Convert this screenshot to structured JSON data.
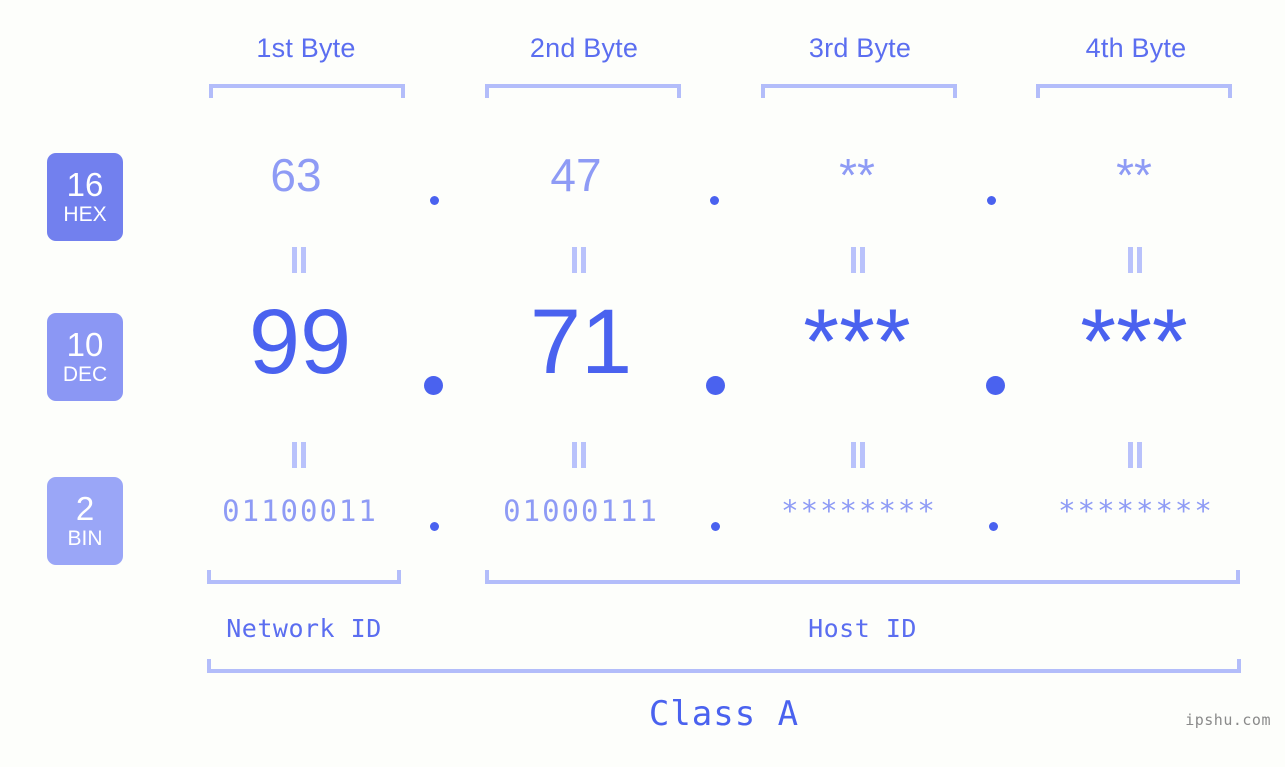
{
  "page": {
    "background": "#fdfefb",
    "watermark": "ipshu.com"
  },
  "colors": {
    "accent_strong": "#4a62ef",
    "accent_medium": "#5b6ef0",
    "accent_light": "#8e9bf5",
    "bracket": "#b3bdfa",
    "connector": "#b9c2fb",
    "badge_hex": "#7280ee",
    "badge_dec": "#8b97f4",
    "badge_bin": "#9aa6f7",
    "watermark": "#8a8a8a"
  },
  "header": {
    "bytes": [
      {
        "label": "1st Byte"
      },
      {
        "label": "2nd Byte"
      },
      {
        "label": "3rd Byte"
      },
      {
        "label": "4th Byte"
      }
    ]
  },
  "radix_badges": [
    {
      "number": "16",
      "name": "HEX"
    },
    {
      "number": "10",
      "name": "DEC"
    },
    {
      "number": "2",
      "name": "BIN"
    }
  ],
  "rows": {
    "hex": {
      "values": [
        "63",
        "47",
        "**",
        "**"
      ],
      "separator": "."
    },
    "dec": {
      "values": [
        "99",
        "71",
        "***",
        "***"
      ],
      "separator": "."
    },
    "bin": {
      "values": [
        "01100011",
        "01000111",
        "********",
        "********"
      ],
      "separator": "."
    }
  },
  "connectors": {
    "symbol": "="
  },
  "footer": {
    "network_id_label": "Network ID",
    "host_id_label": "Host ID",
    "class_label": "Class A"
  }
}
